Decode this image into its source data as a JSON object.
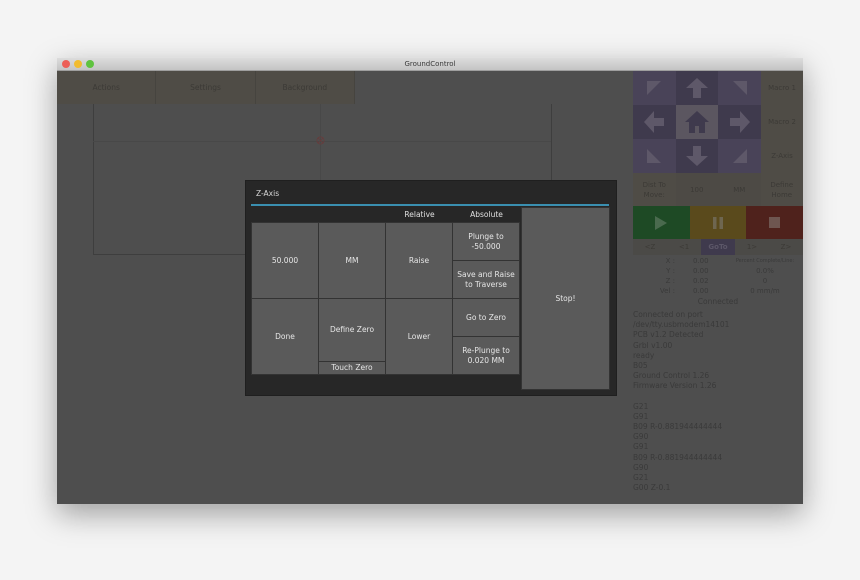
{
  "window": {
    "title": "GroundControl"
  },
  "tabs": [
    "Actions",
    "Settings",
    "Background"
  ],
  "jog": {
    "icons": [
      "arrow-up-left",
      "arrow-up",
      "arrow-up-right",
      "arrow-left",
      "home",
      "arrow-right",
      "arrow-down-left",
      "arrow-down",
      "arrow-down-right"
    ]
  },
  "macros": [
    "Macro 1",
    "Macro 2",
    "Z-Axis"
  ],
  "distance": {
    "label": "Dist To Move:",
    "value": "100",
    "unit": "MM",
    "define_home": "Define Home"
  },
  "run_controls": [
    "play",
    "pause",
    "stop"
  ],
  "step_buttons": [
    "<Z",
    "<1",
    "GoTo",
    "1>",
    "Z>"
  ],
  "coords": [
    {
      "label": "X :",
      "value": "0.00",
      "right": "Percent Complete/Line:"
    },
    {
      "label": "Y :",
      "value": "0.00",
      "right": "0.0%"
    },
    {
      "label": "Z :",
      "value": "0.02",
      "right": "0"
    },
    {
      "label": "Vel :",
      "value": "0.00",
      "right": "0 mm/m"
    }
  ],
  "status": "Connected",
  "log": [
    "Connected on port",
    "/dev/tty.usbmodem14101",
    "PCB v1.2 Detected",
    "Grbl v1.00",
    "ready",
    "B05",
    "Ground Control 1.26",
    "Firmware Version 1.26",
    "",
    "G21",
    "G91",
    "B09 R-0.881944444444",
    "G90",
    "G91",
    "B09 R-0.881944444444",
    "G90",
    "G21",
    "G00 Z-0.1"
  ],
  "modal": {
    "title": "Z-Axis",
    "header_relative": "Relative",
    "header_absolute": "Absolute",
    "distance_value": "50.000",
    "units": "MM",
    "raise": "Raise",
    "lower": "Lower",
    "plunge": "Plunge to -50.000",
    "save_raise": "Save and Raise to Traverse",
    "go_zero": "Go to Zero",
    "replunge": "Re-Plunge to 0.020 MM",
    "done": "Done",
    "define_zero": "Define Zero",
    "touch_zero": "Touch Zero",
    "stop": "Stop!"
  }
}
